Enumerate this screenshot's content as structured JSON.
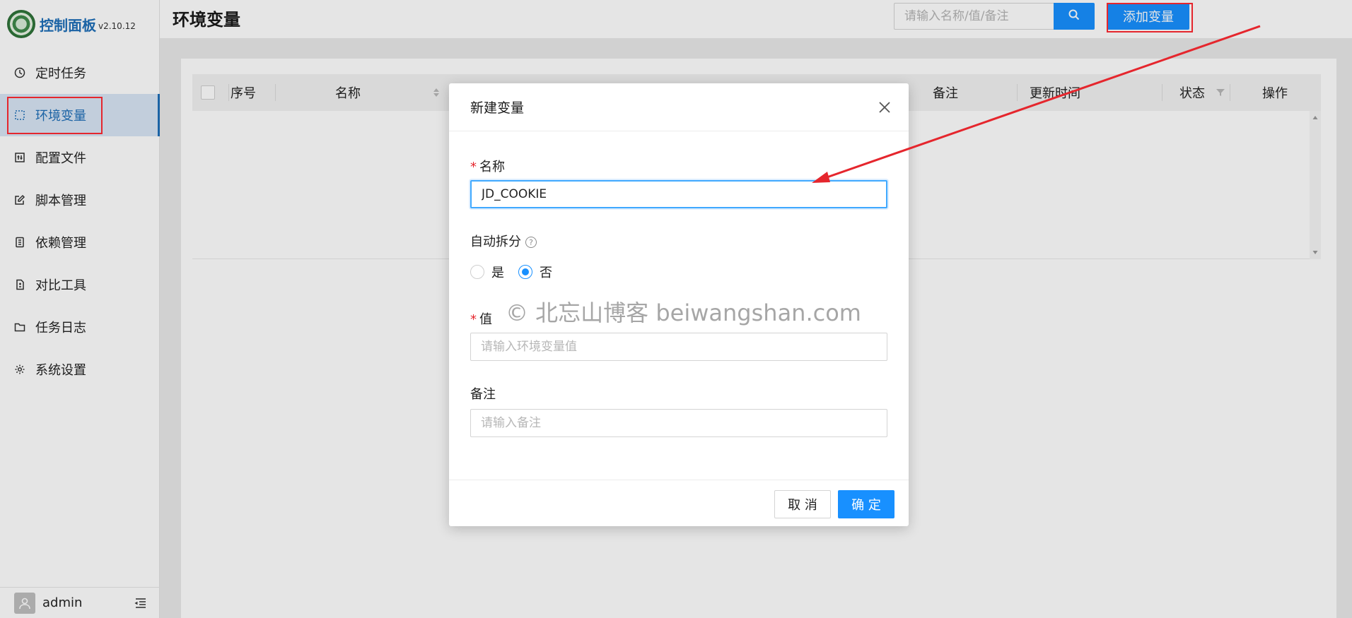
{
  "app": {
    "logo_title": "控制面板",
    "version": "v2.10.12"
  },
  "sidebar": {
    "items": [
      {
        "label": "定时任务",
        "icon": "clock-icon"
      },
      {
        "label": "环境变量",
        "icon": "variable-icon",
        "active": true
      },
      {
        "label": "配置文件",
        "icon": "config-file-icon"
      },
      {
        "label": "脚本管理",
        "icon": "edit-icon"
      },
      {
        "label": "依赖管理",
        "icon": "dependency-icon"
      },
      {
        "label": "对比工具",
        "icon": "diff-icon"
      },
      {
        "label": "任务日志",
        "icon": "folder-icon"
      },
      {
        "label": "系统设置",
        "icon": "gear-icon"
      }
    ],
    "user": "admin"
  },
  "header": {
    "title": "环境变量",
    "search_placeholder": "请输入名称/值/备注",
    "add_button": "添加变量"
  },
  "table": {
    "columns": [
      "序号",
      "名称",
      "备注",
      "更新时间",
      "状态",
      "操作"
    ]
  },
  "modal": {
    "title": "新建变量",
    "name_label": "名称",
    "name_value": "JD_COOKIE",
    "split_label": "自动拆分",
    "split_options": [
      "是",
      "否"
    ],
    "split_selected": "否",
    "value_label": "值",
    "value_placeholder": "请输入环境变量值",
    "remark_label": "备注",
    "remark_placeholder": "请输入备注",
    "cancel": "取 消",
    "ok": "确 定"
  },
  "watermark": "© 北忘山博客 beiwangshan.com",
  "colors": {
    "primary": "#1890ff",
    "highlight": "#e5262d",
    "active_menu_bg": "#d9e6f5"
  }
}
